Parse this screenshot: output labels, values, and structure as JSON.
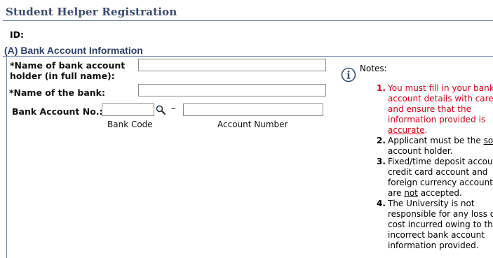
{
  "page": {
    "title": "Student Helper Registration",
    "id_label": "ID:"
  },
  "section": {
    "title": "(A) Bank Account Information"
  },
  "form": {
    "holder_label_line1": "*Name of bank account",
    "holder_label_line2": "holder (in full name):",
    "holder_value": "",
    "bank_label": "*Name of the bank:",
    "bank_value": "",
    "account_label": "Bank Account No.:",
    "bank_code_value": "",
    "account_number_value": "",
    "dash": "–",
    "bank_code_caption": "Bank Code",
    "account_number_caption": "Account Number"
  },
  "notes": {
    "heading": "Notes:",
    "items": [
      {
        "num": "1.",
        "lines": [
          "You must fill in your bank",
          "account details with care",
          "and ensure that the",
          "information provided is"
        ],
        "last_underlined": "accurate",
        "last_tail": "."
      },
      {
        "num": "2.",
        "line1_pre": "Applicant must be the ",
        "line1_u": "sole",
        "line2": "account holder."
      },
      {
        "num": "3.",
        "lines": [
          "Fixed/time deposit account,",
          "credit card account and",
          "foreign currency account"
        ],
        "last_pre": "are ",
        "last_u": "not",
        "last_tail": " accepted."
      },
      {
        "num": "4.",
        "lines": [
          "The University is not",
          "responsible for any loss or",
          "cost incurred owing to the",
          "incorrect bank account",
          "information provided."
        ]
      }
    ]
  },
  "icons": {
    "search": "search-icon",
    "info": "info-icon"
  },
  "colors": {
    "title": "#3c4a6e",
    "section": "#2f4069",
    "rule": "#7a86a8",
    "note_red": "#d0021b"
  }
}
